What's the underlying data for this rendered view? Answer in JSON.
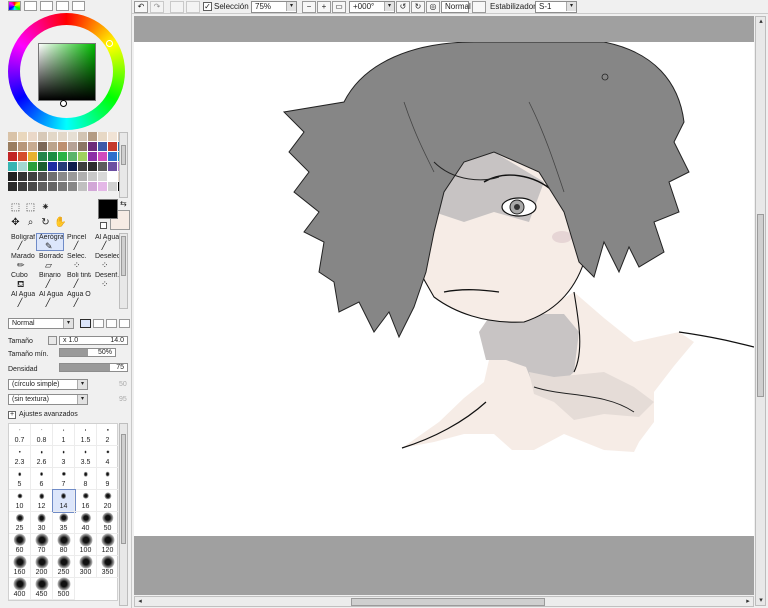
{
  "left_panel": {
    "mini_tabs": [
      "",
      "",
      "",
      "",
      ""
    ],
    "tool_buttons": [
      "⬚",
      "⬚",
      "⁕",
      "",
      "",
      "",
      "✥",
      "⌕",
      "↻",
      "✋",
      "",
      ""
    ],
    "swap_glyph": "⇆",
    "palette": [
      "#d9c3a8",
      "#e9d7bd",
      "#ead8c8",
      "#d7c9b8",
      "#e2d7c7",
      "#e3d8c9",
      "#e6dfd4",
      "#d2c4b3",
      "#b49c84",
      "#e7d8c5",
      "#f1e3d5",
      "#d8c9ba",
      "#9a7d60",
      "#b8977a",
      "#c8ab91",
      "#7c6858",
      "#bca48c",
      "#be9070",
      "#b6a296",
      "#8b7665",
      "#6d2b7a",
      "#3e5aa9",
      "#c53a2d",
      "#2b68a7",
      "#c22525",
      "#d54d2b",
      "#e8b22e",
      "#24864a",
      "#1d8e43",
      "#2ab346",
      "#5ab56b",
      "#9fd25e",
      "#8d2ea7",
      "#d14bbd",
      "#2f6fcb",
      "#2091c4",
      "#38b5b2",
      "#a3d8d1",
      "#2a9f3b",
      "#1a5f2f",
      "#1d2ca3",
      "#243a78",
      "#0d1c4c",
      "#3d3d3d",
      "#2c2c2c",
      "#5c5c5c",
      "#6c4fa1",
      "#b57ad1",
      "#202020",
      "#333333",
      "#404040",
      "#505050",
      "#707070",
      "#8a8a8a",
      "#9a9a9a",
      "#b0b0b0",
      "#c8c8c8",
      "#d8d8d8",
      "#ffffff",
      "#e8d6c7",
      "#2a2a2a",
      "#3c3c3c",
      "#4a4a4a",
      "#5f5f5f",
      "#666666",
      "#787878",
      "#888888",
      "#c0c0c0",
      "#d2a7d7",
      "#e4b7e7",
      "#d1d1d1",
      "#000000"
    ],
    "brushes": [
      {
        "label": "Bolígrafo",
        "icon": "╱"
      },
      {
        "label": "Aerógrafo",
        "icon": "✎"
      },
      {
        "label": "Pincel",
        "icon": "╱"
      },
      {
        "label": "Al Agua",
        "icon": "╱"
      },
      {
        "label": "Marador",
        "icon": "✏"
      },
      {
        "label": "Borrador",
        "icon": "▱"
      },
      {
        "label": "Selec.",
        "icon": "⁘"
      },
      {
        "label": "Deselec.",
        "icon": "⁘"
      },
      {
        "label": "Cubo",
        "icon": "⛾"
      },
      {
        "label": "Binario",
        "icon": "╱"
      },
      {
        "label": "Boli tinta",
        "icon": "╱"
      },
      {
        "label": "Desenf.",
        "icon": "⁘"
      },
      {
        "label": "Al Agua",
        "icon": "╱"
      },
      {
        "label": "Al Agua",
        "icon": "╱"
      },
      {
        "label": "Agua Ol",
        "icon": "╱"
      },
      {
        "label": "",
        "icon": ""
      }
    ],
    "blend_mode": "Normal",
    "size_label": "Tamaño",
    "size_mult": "x 1.0",
    "size_value": "14.0",
    "min_size_label": "Tamaño mín.",
    "min_size_value": "50%",
    "min_size_fraction": 0.5,
    "density_label": "Densidad",
    "density_value": "75",
    "density_fraction": 0.75,
    "shape_select": "(círculo simple)",
    "shape_value": "50",
    "texture_select": "(sin textura)",
    "texture_value": "95",
    "advanced_label": "Ajustes avanzados",
    "advanced_glyph": "+",
    "sizes": [
      "0.7",
      "0.8",
      "1",
      "1.5",
      "2",
      "2.3",
      "2.6",
      "3",
      "3.5",
      "4",
      "5",
      "6",
      "7",
      "8",
      "9",
      "10",
      "12",
      "14",
      "16",
      "20",
      "25",
      "30",
      "35",
      "40",
      "50",
      "60",
      "70",
      "80",
      "100",
      "120",
      "160",
      "200",
      "250",
      "300",
      "350",
      "400",
      "450",
      "500"
    ],
    "selected_size": "14"
  },
  "topbar": {
    "undo": "↶",
    "redo": "↷",
    "selection_label": "Selección",
    "selection_checked": "✓",
    "zoom": "75%",
    "zoom_minus": "−",
    "zoom_plus": "+",
    "zoom_reset": "▭",
    "rotation": "+000°",
    "rotate_left": "↺",
    "rotate_right": "↻",
    "rotate_reset": "◎",
    "mode": "Normal",
    "stabilizer_label": "Estabilizador",
    "stabilizer_value": "S-1",
    "dropdown_glyph": "▾"
  },
  "scroll_arrows": {
    "left": "◂",
    "right": "▸",
    "up": "▴",
    "down": "▾"
  },
  "colors": {
    "panel": "#f0f0f0",
    "canvas_bg": "#a0a0a0",
    "skin": "#f5e9e3",
    "hair": "#868686",
    "shadow": "#c8c8c8",
    "selection": "#dce6fb"
  }
}
